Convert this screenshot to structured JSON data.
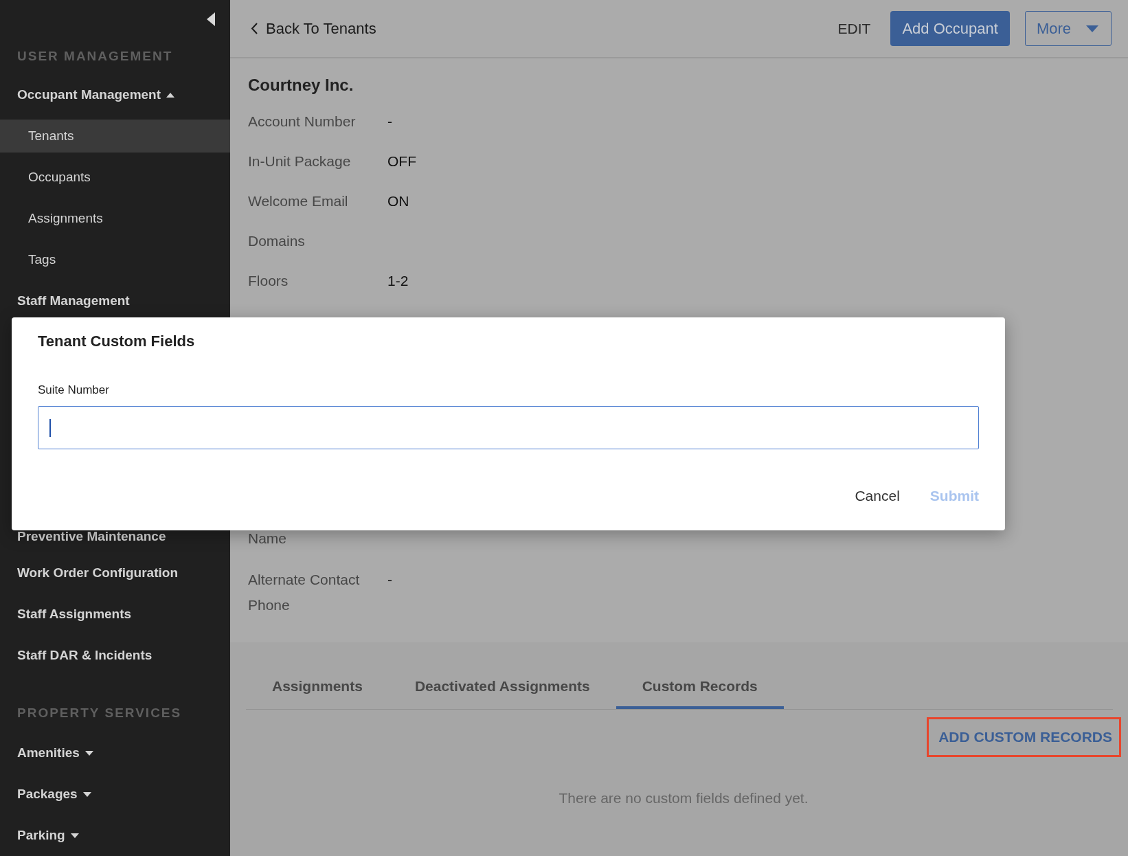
{
  "sidebar": {
    "sections": [
      {
        "heading": "USER MANAGEMENT",
        "items": [
          {
            "kind": "group",
            "label": "Occupant Management",
            "expanded": true,
            "children": [
              {
                "label": "Tenants",
                "selected": true
              },
              {
                "label": "Occupants",
                "selected": false
              },
              {
                "label": "Assignments",
                "selected": false
              },
              {
                "label": "Tags",
                "selected": false
              }
            ]
          },
          {
            "kind": "link",
            "label": "Staff Management"
          },
          {
            "kind": "link",
            "label": "Preventive Maintenance"
          },
          {
            "kind": "link",
            "label": "Work Order Configuration"
          },
          {
            "kind": "link",
            "label": "Staff Assignments"
          },
          {
            "kind": "link",
            "label": "Staff DAR & Incidents"
          }
        ]
      },
      {
        "heading": "PROPERTY SERVICES",
        "items": [
          {
            "kind": "group",
            "label": "Amenities",
            "expanded": false
          },
          {
            "kind": "group",
            "label": "Packages",
            "expanded": false
          },
          {
            "kind": "group",
            "label": "Parking",
            "expanded": false
          }
        ]
      }
    ]
  },
  "header": {
    "back_link": "Back To Tenants",
    "edit": "EDIT",
    "primary_button": "Add Occupant",
    "more_button": "More"
  },
  "tenant": {
    "name": "Courtney Inc.",
    "fields": [
      {
        "label": "Account Number",
        "value": "-"
      },
      {
        "label": "In-Unit Package",
        "value": "OFF"
      },
      {
        "label": "Welcome Email",
        "value": "ON"
      },
      {
        "label": "Domains"
      },
      {
        "label": "Floors",
        "value": "1-2"
      },
      {
        "label": "Name"
      },
      {
        "label": "Alternate Contact Phone",
        "value": "-"
      }
    ]
  },
  "tabs": [
    {
      "label": "Assignments",
      "selected": false
    },
    {
      "label": "Deactivated Assignments",
      "selected": false
    },
    {
      "label": "Custom Records",
      "selected": true
    }
  ],
  "add_button": {
    "label": "ADD CUSTOM RECORDS",
    "highlighted": true
  },
  "empty_message": "There are no custom fields defined yet.",
  "dialog": {
    "title": "Tenant Custom Fields",
    "field": {
      "label": "Suite Number",
      "focused": true
    },
    "buttons": [
      {
        "label": "Cancel",
        "disabled": false
      },
      {
        "label": "Submit",
        "disabled": true
      }
    ]
  }
}
